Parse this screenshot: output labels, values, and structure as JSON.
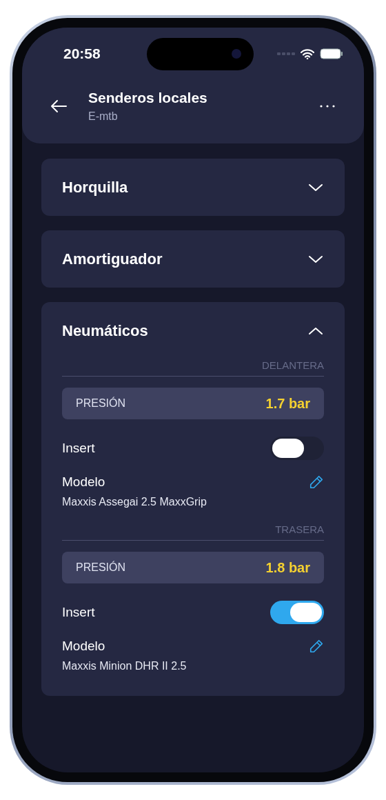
{
  "status_bar": {
    "time": "20:58"
  },
  "header": {
    "title": "Senderos locales",
    "subtitle": "E-mtb"
  },
  "sections": [
    {
      "title": "Horquilla",
      "expanded": false
    },
    {
      "title": "Amortiguador",
      "expanded": false
    },
    {
      "title": "Neumáticos",
      "expanded": true,
      "groups": [
        {
          "label": "DELANTERA",
          "pressure_label": "PRESIÓN",
          "pressure": "1.7 bar",
          "insert_label": "Insert",
          "insert_on": false,
          "model_label": "Modelo",
          "model": "Maxxis Assegai 2.5 MaxxGrip"
        },
        {
          "label": "TRASERA",
          "pressure_label": "PRESIÓN",
          "pressure": "1.8 bar",
          "insert_label": "Insert",
          "insert_on": true,
          "model_label": "Modelo",
          "model": "Maxxis Minion DHR II 2.5"
        }
      ]
    }
  ]
}
